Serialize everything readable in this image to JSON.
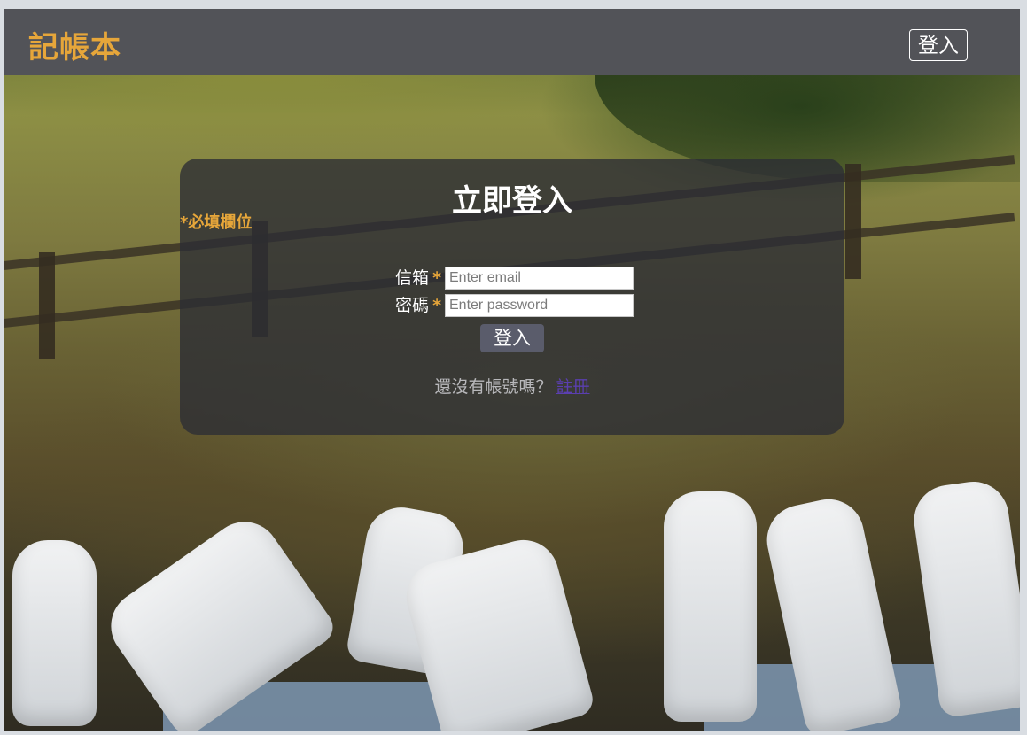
{
  "navbar": {
    "brand": "記帳本",
    "login_button": "登入"
  },
  "login_card": {
    "title": "立即登入",
    "required_note": "*必填欄位",
    "email": {
      "label": "信箱",
      "required_mark": "*",
      "placeholder": "Enter email",
      "value": ""
    },
    "password": {
      "label": "密碼",
      "required_mark": "*",
      "placeholder": "Enter password",
      "value": ""
    },
    "submit_label": "登入",
    "signup_prompt": "還沒有帳號嗎？",
    "signup_link": "註冊"
  },
  "colors": {
    "accent": "#e6a63a",
    "navbar_bg": "#525358",
    "card_bg": "rgba(43,45,52,0.78)",
    "button_bg": "#5a5c6b",
    "link": "#5b3fb0"
  }
}
